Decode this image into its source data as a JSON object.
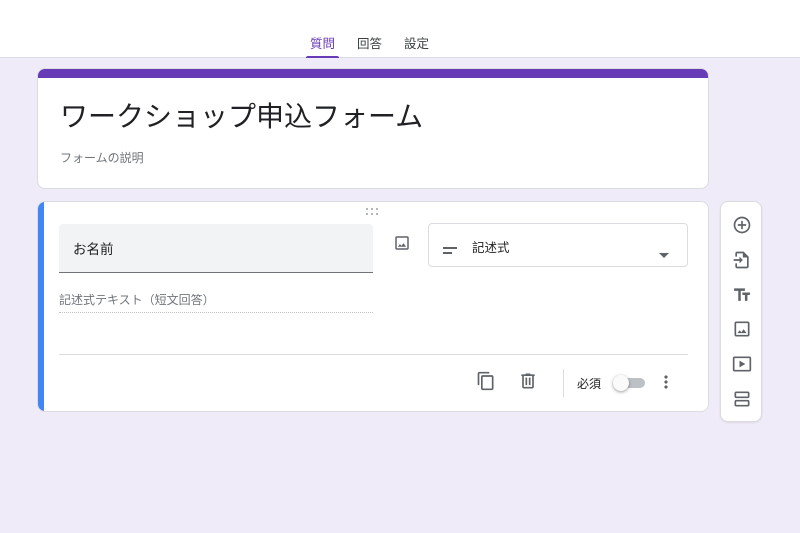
{
  "tabs": [
    {
      "label": "質問",
      "active": true
    },
    {
      "label": "回答",
      "active": false
    },
    {
      "label": "設定",
      "active": false
    }
  ],
  "form": {
    "title": "ワークショップ申込フォーム",
    "description": "フォームの説明"
  },
  "question": {
    "title": "お名前",
    "type_label": "記述式",
    "answer_placeholder": "記述式テキスト（短文回答）",
    "required_label": "必須",
    "required": false
  },
  "icons": {
    "add_image": "image-icon",
    "type_short_answer": "short-text-icon",
    "type_dropdown": "dropdown-caret-icon",
    "duplicate": "copy-icon",
    "delete": "trash-icon",
    "more": "more-vert-icon",
    "side_tools": [
      "add-circle-icon",
      "import-icon",
      "title-text-icon",
      "image-icon",
      "video-icon",
      "section-icon"
    ]
  },
  "colors": {
    "accent": "#673ab7",
    "focus": "#4285f4",
    "background": "#f0ebf8"
  }
}
